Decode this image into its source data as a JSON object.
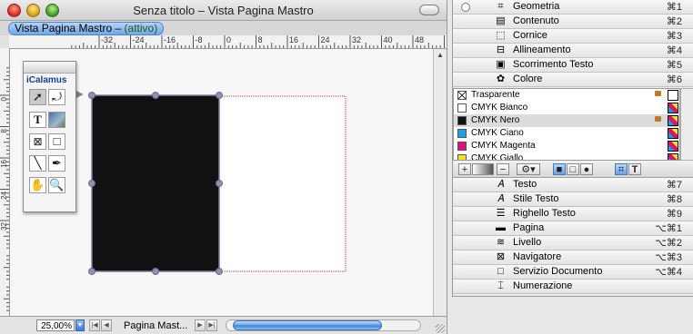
{
  "window": {
    "title": "Senza titolo – Vista Pagina Mastro",
    "tab_label": "Vista Pagina Mastro –",
    "tab_status": "(attivo)"
  },
  "hruler_ticks": [
    "-32",
    "-24",
    "-16",
    "-8",
    "0",
    "8",
    "16",
    "24",
    "32",
    "40",
    "48",
    "56"
  ],
  "vruler_ticks": [
    "0",
    "8",
    "16",
    "24",
    "32"
  ],
  "toolbox": {
    "title": "iCalamus"
  },
  "bottom": {
    "zoom": "25,00%",
    "page": "Pagina Mast..."
  },
  "panel": {
    "rows_top": [
      {
        "label": "Geometria",
        "shortcut": "⌘1",
        "icon": "geometry-icon"
      },
      {
        "label": "Contenuto",
        "shortcut": "⌘2",
        "icon": "content-icon"
      },
      {
        "label": "Cornice",
        "shortcut": "⌘3",
        "icon": "frame-icon"
      },
      {
        "label": "Allineamento",
        "shortcut": "⌘4",
        "icon": "align-icon"
      },
      {
        "label": "Scorrimento Testo",
        "shortcut": "⌘5",
        "icon": "text-flow-icon"
      },
      {
        "label": "Colore",
        "shortcut": "⌘6",
        "icon": "palette-icon"
      }
    ],
    "colors": [
      {
        "name": "Trasparente",
        "swatch": "#ffffff",
        "locked": true,
        "transparent": true
      },
      {
        "name": "CMYK Bianco",
        "swatch": "#ffffff",
        "locked": false
      },
      {
        "name": "CMYK Nero",
        "swatch": "#111111",
        "locked": true
      },
      {
        "name": "CMYK Ciano",
        "swatch": "#1aa0e8",
        "locked": false
      },
      {
        "name": "CMYK Magenta",
        "swatch": "#e0107a",
        "locked": false
      },
      {
        "name": "CMYK Giallo",
        "swatch": "#f2e41a",
        "locked": false
      }
    ],
    "rows_bottom": [
      {
        "label": "Testo",
        "shortcut": "⌘7",
        "icon": "text-icon"
      },
      {
        "label": "Stile Testo",
        "shortcut": "⌘8",
        "icon": "text-style-icon"
      },
      {
        "label": "Righello Testo",
        "shortcut": "⌘9",
        "icon": "text-ruler-icon"
      },
      {
        "label": "Pagina",
        "shortcut": "⌥⌘1",
        "icon": "page-icon"
      },
      {
        "label": "Livello",
        "shortcut": "⌥⌘2",
        "icon": "layer-icon"
      },
      {
        "label": "Navigatore",
        "shortcut": "⌥⌘3",
        "icon": "navigator-icon"
      },
      {
        "label": "Servizio Documento",
        "shortcut": "⌥⌘4",
        "icon": "document-service-icon"
      },
      {
        "label": "Numerazione",
        "shortcut": "",
        "icon": "numbering-icon"
      }
    ]
  }
}
